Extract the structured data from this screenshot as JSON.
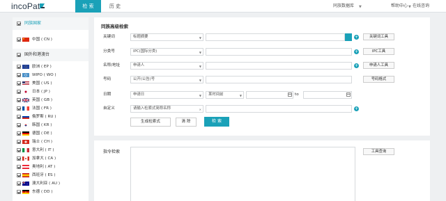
{
  "brand": {
    "logo_text": "incoPat",
    "accent": "#1aa1b8"
  },
  "top_nav": {
    "tabs": [
      {
        "label": "检 索",
        "active": true
      },
      {
        "label": "历 史",
        "active": false
      }
    ],
    "database": "同族数据库",
    "help": "帮助中心",
    "online": "在线咨询"
  },
  "sidebar": {
    "section1": {
      "label": "同族国家",
      "checked": true
    },
    "china": {
      "label": "中国 ( CN )",
      "checked": true
    },
    "section2": {
      "label": "国外和港澳台",
      "checked": true
    },
    "items": [
      {
        "label": "欧洲 ( EP )",
        "flag": "eu-flag-icon",
        "checked": true
      },
      {
        "label": "WIPO ( WO )",
        "flag": "wipo-flag-icon",
        "checked": true
      },
      {
        "label": "美国 ( US )",
        "flag": "us-flag-icon",
        "checked": true
      },
      {
        "label": "日本 ( JP )",
        "flag": "jp-flag-icon",
        "checked": true
      },
      {
        "label": "英国 ( GB )",
        "flag": "gb-flag-icon",
        "checked": true
      },
      {
        "label": "法国 ( FR )",
        "flag": "fr-flag-icon",
        "checked": true
      },
      {
        "label": "俄罗斯 ( RU )",
        "flag": "ru-flag-icon",
        "checked": true
      },
      {
        "label": "韩国 ( KR )",
        "flag": "kr-flag-icon",
        "checked": true
      },
      {
        "label": "德国 ( DE )",
        "flag": "de-flag-icon",
        "checked": true
      },
      {
        "label": "瑞士 ( CH )",
        "flag": "ch-flag-icon",
        "checked": true
      },
      {
        "label": "意大利 ( IT )",
        "flag": "it-flag-icon",
        "checked": true
      },
      {
        "label": "加拿大 ( CA )",
        "flag": "ca-flag-icon",
        "checked": true
      },
      {
        "label": "奥地利 ( AT )",
        "flag": "at-flag-icon",
        "checked": true
      },
      {
        "label": "西班牙 ( ES )",
        "flag": "es-flag-icon",
        "checked": true
      },
      {
        "label": "澳大利亚 ( AU )",
        "flag": "au-flag-icon",
        "checked": true
      },
      {
        "label": "东德 ( DD )",
        "flag": "dd-flag-icon",
        "checked": true
      }
    ]
  },
  "form": {
    "title": "同族高级检索",
    "keyword": {
      "label": "关键词",
      "select": "标题摘要",
      "button": "关键词工具"
    },
    "classification": {
      "label": "分类号",
      "select": "IPC(国际分类)",
      "button": "IPC工具"
    },
    "applicant": {
      "label": "名称/地址",
      "select": "申请人",
      "button": "申请人工具"
    },
    "number": {
      "label": "号码",
      "select": "公开(公告)号",
      "button": "号码格式"
    },
    "date": {
      "label": "日期",
      "select": "申请日",
      "range_select": "某时间前",
      "to": "to"
    },
    "custom": {
      "label": "自定义",
      "placeholder": "请输入检索式简称名称"
    },
    "buttons": {
      "generate": "生成检索式",
      "clear": "清 除",
      "search": "检 索"
    }
  },
  "command": {
    "label": "指令检索",
    "button": "工具查询"
  }
}
